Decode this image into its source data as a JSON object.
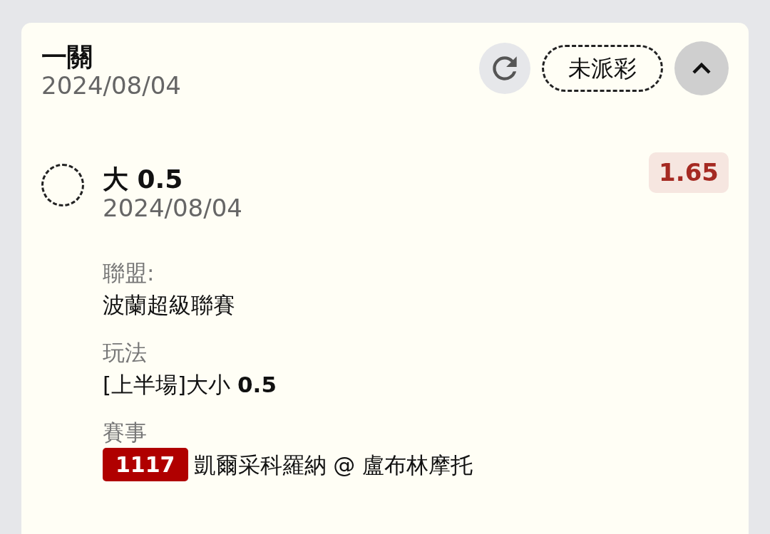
{
  "header": {
    "title": "一關",
    "date": "2024/08/04",
    "status": "未派彩",
    "expanded": true
  },
  "selection": {
    "selected": false,
    "title": "大 0.5",
    "date": "2024/08/04",
    "odds": "1.65"
  },
  "details": [
    {
      "kind": "text",
      "label": "聯盟:",
      "value": "波蘭超級聯賽"
    },
    {
      "kind": "text",
      "label": "玩法",
      "value": "[上半場]大小 **0.5**"
    },
    {
      "kind": "match",
      "label": "賽事",
      "number": "1117",
      "value": "凱爾采科羅納 @ 盧布林摩托"
    }
  ]
}
